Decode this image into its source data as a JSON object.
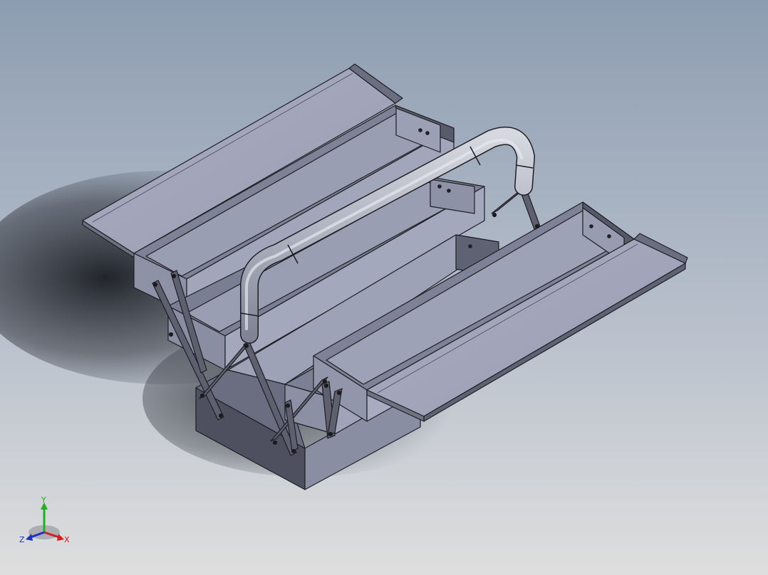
{
  "viewport": {
    "background_top": "#8d9db1",
    "background_bottom": "#dedede"
  },
  "model": {
    "face_light": "#a4a8bc",
    "face_mid": "#8c90a4",
    "face_dark": "#5a5c68",
    "edge_color": "#1e1e24"
  },
  "triad": {
    "x_label": "X",
    "y_label": "Y",
    "z_label": "Z",
    "x_color": "#d02020",
    "y_color": "#20b020",
    "z_color": "#2030c0"
  }
}
